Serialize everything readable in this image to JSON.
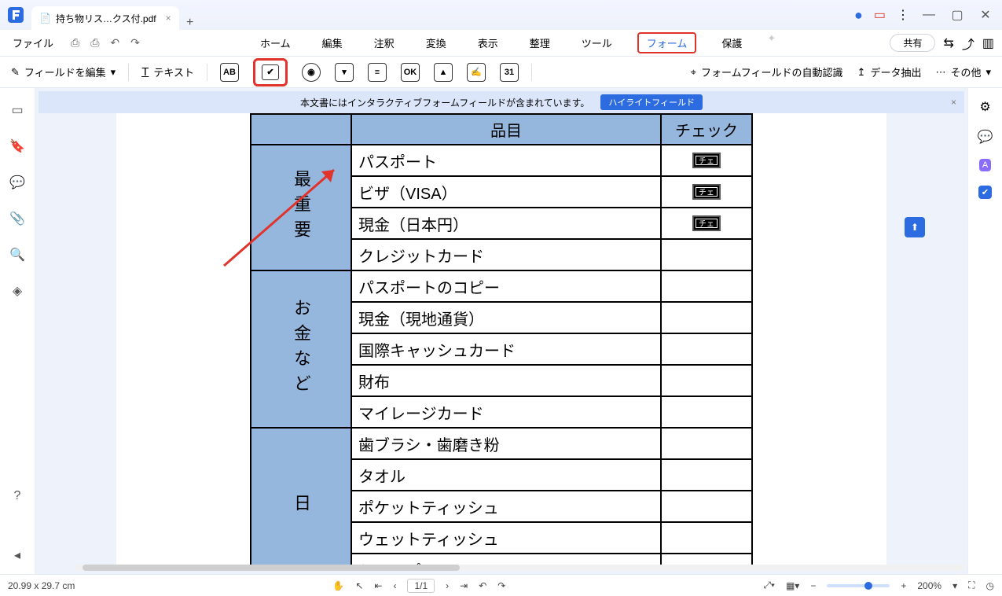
{
  "titlebar": {
    "app_color": "#2d6be0",
    "tab_title": "持ち物リス…クス付.pdf",
    "add_tab": "+"
  },
  "menubar": {
    "file_label": "ファイル",
    "tabs": [
      "ホーム",
      "編集",
      "注釈",
      "変換",
      "表示",
      "整理",
      "ツール",
      "フォーム",
      "保護"
    ],
    "active_tab_index": 7,
    "share_label": "共有"
  },
  "toolbar": {
    "edit_fields_label": "フィールドを編集",
    "text_label": "テキスト",
    "auto_detect_label": "フォームフィールドの自動認識",
    "data_extract_label": "データ抽出",
    "more_label": "その他"
  },
  "infobar": {
    "message": "本文書にはインタラクティブフォームフィールドが含まれています。",
    "highlight_label": "ハイライトフィールド"
  },
  "table": {
    "col1": "品目",
    "col2": "チェック",
    "sections": [
      {
        "category": "最重要",
        "rows": [
          {
            "name": "パスポート",
            "chk": true
          },
          {
            "name": "ビザ（VISA）",
            "chk": true
          },
          {
            "name": "現金（日本円）",
            "chk": true
          },
          {
            "name": "クレジットカード",
            "chk": false
          }
        ]
      },
      {
        "category": "お金など",
        "rows": [
          {
            "name": "パスポートのコピー",
            "chk": false
          },
          {
            "name": "現金（現地通貨）",
            "chk": false
          },
          {
            "name": "国際キャッシュカード",
            "chk": false
          },
          {
            "name": "財布",
            "chk": false
          },
          {
            "name": "マイレージカード",
            "chk": false
          }
        ]
      },
      {
        "category": "日",
        "rows": [
          {
            "name": "歯ブラシ・歯磨き粉",
            "chk": false
          },
          {
            "name": "タオル",
            "chk": false
          },
          {
            "name": "ポケットティッシュ",
            "chk": false
          },
          {
            "name": "ウェットティッシュ",
            "chk": false
          },
          {
            "name": "シャンプー・リンス",
            "chk": false
          }
        ]
      }
    ],
    "chk_boxtext": "チェ"
  },
  "statusbar": {
    "size": "20.99 x 29.7 cm",
    "page_current": "1",
    "page_total": "/1",
    "zoom": "200%"
  }
}
